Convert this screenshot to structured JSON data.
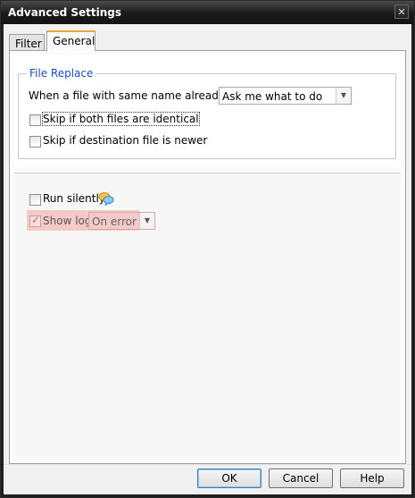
{
  "window": {
    "title": "Advanced Settings",
    "close_glyph": "✕"
  },
  "tabs": [
    {
      "label": "Filter"
    },
    {
      "label": "General"
    }
  ],
  "file_replace": {
    "group_label": "File Replace",
    "prompt_label": "When a file with same name already exists:",
    "action_value": "Ask me what to do",
    "skip_identical_label": "Skip if both files are identical",
    "skip_newer_label": "Skip if destination file is newer"
  },
  "logging": {
    "run_silently_label": "Run silently",
    "show_log_label": "Show log",
    "show_log_checked": true,
    "log_value": "On error",
    "info_icon": "chat-bubbles-icon",
    "highlight_color": "#f6c9c9"
  },
  "buttons": {
    "ok": "OK",
    "cancel": "Cancel",
    "help": "Help"
  }
}
